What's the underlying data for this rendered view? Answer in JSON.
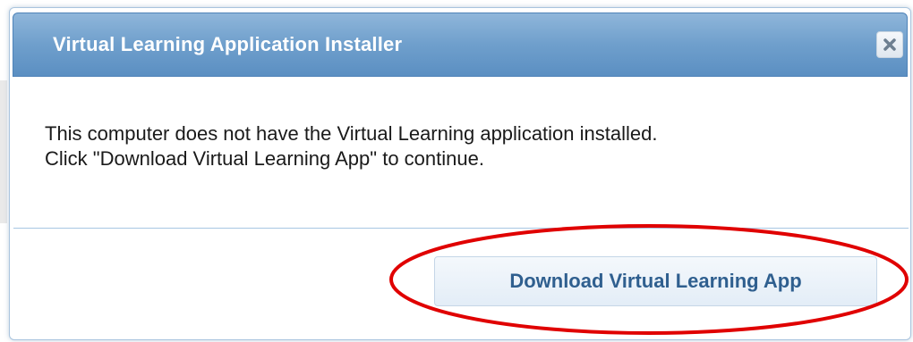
{
  "dialog": {
    "title": "Virtual Learning Application Installer",
    "close_icon": "close-x-icon",
    "message_lines": [
      "This computer does not have the Virtual Learning application installed.",
      "Click \"Download Virtual Learning App\" to continue."
    ],
    "download_button_label": "Download Virtual Learning App"
  },
  "annotation": {
    "shape": "ellipse",
    "color": "#e00000"
  },
  "colors": {
    "titlebar": "#6f9fcc",
    "button_text": "#2f5f8f"
  }
}
